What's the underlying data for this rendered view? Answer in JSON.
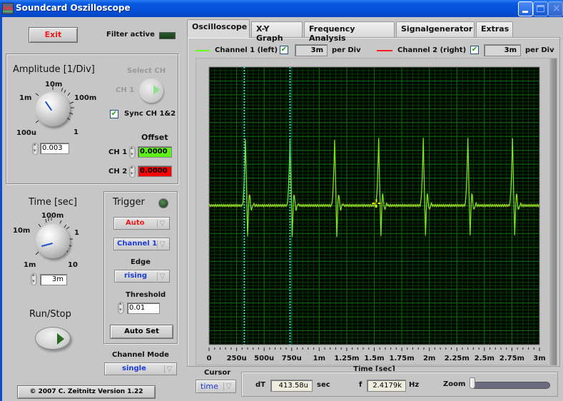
{
  "window": {
    "title": "Soundcard Oszilloscope",
    "controls": [
      "minimize",
      "maximize",
      "close"
    ]
  },
  "left_panel": {
    "exit_label": "Exit",
    "filter_label": "Filter active",
    "filter_led": "off",
    "amplitude": {
      "title": "Amplitude [1/Div]",
      "knob_labels": [
        "100u",
        "1m",
        "10m",
        "100m",
        "1"
      ],
      "value": "0.003",
      "select_ch_label": "Select CH",
      "select_ch_value": "CH 1",
      "sync_label": "Sync CH 1&2",
      "sync_checked": true,
      "offset_label": "Offset",
      "ch1_label": "CH 1",
      "ch1_offset": "0.0000",
      "ch2_label": "CH 2",
      "ch2_offset": "0.0000"
    },
    "time": {
      "title": "Time [sec]",
      "knob_labels": [
        "1m",
        "10m",
        "100m",
        "1",
        "10"
      ],
      "value": "3m"
    },
    "trigger": {
      "title": "Trigger",
      "mode": "Auto",
      "source": "Channel 1",
      "edge_label": "Edge",
      "edge": "rising",
      "threshold_label": "Threshold",
      "threshold": "0.01",
      "auto_set_label": "Auto Set"
    },
    "run_stop_label": "Run/Stop",
    "channel_mode_label": "Channel Mode",
    "channel_mode": "single",
    "copyright": "© 2007   C. Zeitnitz Version 1.22"
  },
  "tabs": [
    {
      "label": "Oscilloscope",
      "active": true
    },
    {
      "label": "X-Y Graph",
      "active": false
    },
    {
      "label": "Frequency Analysis",
      "active": false
    },
    {
      "label": "Signalgenerator",
      "active": false
    },
    {
      "label": "Extras",
      "active": false
    }
  ],
  "channels": {
    "ch1": {
      "label": "Channel 1 (left)",
      "checked": true,
      "per_div": "3m",
      "per_div_label": "per Div",
      "color": "#66ff22"
    },
    "ch2": {
      "label": "Channel 2 (right)",
      "checked": true,
      "per_div": "3m",
      "per_div_label": "per Div",
      "color": "#ff2020"
    }
  },
  "chart_data": {
    "type": "line",
    "title": "",
    "xlabel": "Time [sec]",
    "ylabel": "",
    "xlim": [
      0,
      0.003
    ],
    "x_tick_labels": [
      "0",
      "250u",
      "500u",
      "750u",
      "1m",
      "1.25m",
      "1.5m",
      "1.75m",
      "2m",
      "2.25m",
      "2.5m",
      "2.75m",
      "3m"
    ],
    "grid": true,
    "background": "#000800",
    "grid_color": "#0e6a0e",
    "series": [
      {
        "name": "Channel 1 (left)",
        "color": "#66ff22",
        "pulse_times": [
          0.00033,
          0.000735,
          0.00114,
          0.00154,
          0.001945,
          0.00235,
          0.002755
        ],
        "period": 0.000405,
        "baseline_div": 0,
        "peak_div": 4.8,
        "trough_div": -2.2
      },
      {
        "name": "Channel 2 (right)",
        "color": "#cc3322",
        "pulse_times": [
          0.00033,
          0.000735,
          0.00114,
          0.00154,
          0.001945,
          0.00235,
          0.002755
        ],
        "period": 0.000405,
        "baseline_div": 0,
        "peak_div": 4.8,
        "trough_div": -2.2
      }
    ],
    "cursors": [
      0.00032,
      0.000735
    ],
    "cursor_color": "#22dddd",
    "crosshair": {
      "x": 0.0015,
      "label": "trigger-marker"
    }
  },
  "cursor_bar": {
    "cursor_label": "Cursor",
    "cursor_mode": "time",
    "dt_label": "dT",
    "dt_value": "413.58u",
    "dt_unit": "sec",
    "f_label": "f",
    "f_value": "2.4179k",
    "f_unit": "Hz",
    "zoom_label": "Zoom",
    "zoom_level": 0
  }
}
